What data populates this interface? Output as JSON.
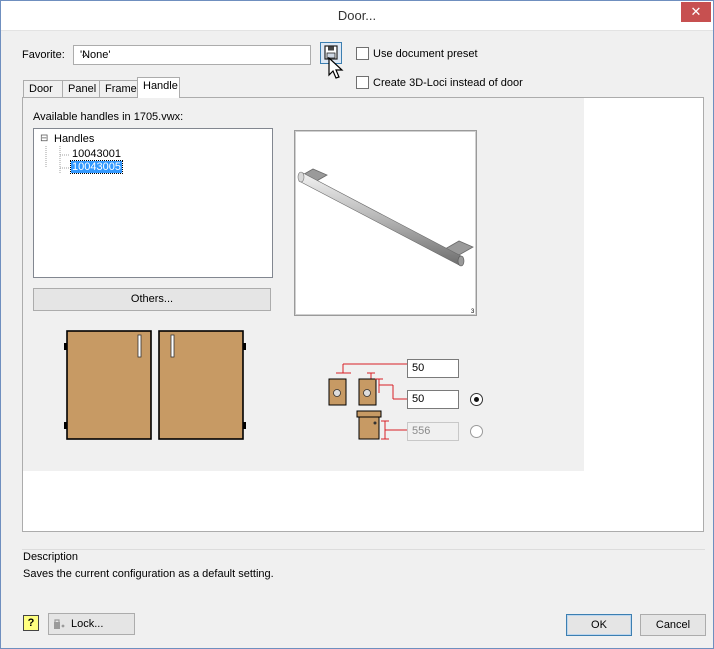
{
  "window": {
    "title": "Door...",
    "close_glyph": "✕"
  },
  "favorite": {
    "label": "Favorite:",
    "value": "'None'",
    "save_icon": "floppy-save-icon",
    "use_preset_label": "Use document preset",
    "use_preset_checked": false,
    "loci_label": "Create 3D-Loci instead of door",
    "loci_checked": false
  },
  "tabs": [
    {
      "label": "Door",
      "active": false
    },
    {
      "label": "Panel",
      "active": false
    },
    {
      "label": "Frame",
      "active": false
    },
    {
      "label": "Handle",
      "active": true
    }
  ],
  "handle": {
    "available_label": "Available handles in 1705.vwx:",
    "tree": {
      "root": "Handles",
      "expander": "⊟",
      "items": [
        {
          "label": "10043001",
          "selected": false
        },
        {
          "label": "10043005",
          "selected": true
        }
      ]
    },
    "others_button": "Others...",
    "preview_mark": "3",
    "offset_horizontal": "50",
    "offset_vertical": "50",
    "offset_height": "556",
    "radio_vertical_selected": true,
    "radio_height_selected": false
  },
  "description": {
    "label": "Description",
    "text": "Saves the current configuration as a default setting."
  },
  "footer": {
    "help_icon": "?",
    "lock_label": "Lock...",
    "ok_label": "OK",
    "cancel_label": "Cancel"
  },
  "colors": {
    "accent": "#3399ff",
    "door_fill": "#c79a64",
    "dimension_red": "#d81f26",
    "close_button": "#c75050"
  }
}
